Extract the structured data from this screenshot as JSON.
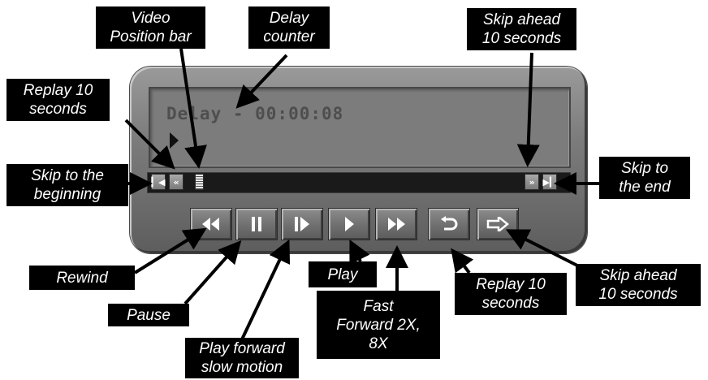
{
  "screen": {
    "delay_text": "Delay - 00:00:08"
  },
  "callouts": {
    "video_position_bar": [
      "Video",
      "Position bar"
    ],
    "delay_counter": [
      "Delay",
      "counter"
    ],
    "skip_ahead_top": [
      "Skip ahead",
      "10 seconds"
    ],
    "replay_top": [
      "Replay 10",
      "seconds"
    ],
    "skip_beginning": [
      "Skip to the",
      "beginning"
    ],
    "skip_end": [
      "Skip to",
      "the end"
    ],
    "rewind": [
      "Rewind"
    ],
    "pause": [
      "Pause"
    ],
    "play_slow": [
      "Play forward",
      "slow motion"
    ],
    "play": [
      "Play"
    ],
    "fast_forward": [
      "Fast",
      "Forward 2X,",
      "8X"
    ],
    "replay_bottom": [
      "Replay 10",
      "seconds"
    ],
    "skip_ahead_bottom": [
      "Skip ahead",
      "10 seconds"
    ]
  },
  "icons": {
    "skip_to_beginning": "skip-to-beginning-icon",
    "replay_10_small": "double-chevron-left-icon",
    "skip_ahead_10_small": "double-chevron-right-icon",
    "skip_to_end": "skip-to-end-icon",
    "rewind": "rewind-icon",
    "pause": "pause-icon",
    "slow_motion": "slow-motion-icon",
    "play": "play-icon",
    "fast_forward": "fast-forward-icon",
    "replay": "replay-icon",
    "skip_ahead": "skip-ahead-arrow-icon"
  },
  "colors": {
    "body": "#7b7b7b",
    "screen": "#7c7c7c",
    "track": "#1a1a1a",
    "callout_bg": "#000000",
    "callout_text": "#ffffff"
  }
}
